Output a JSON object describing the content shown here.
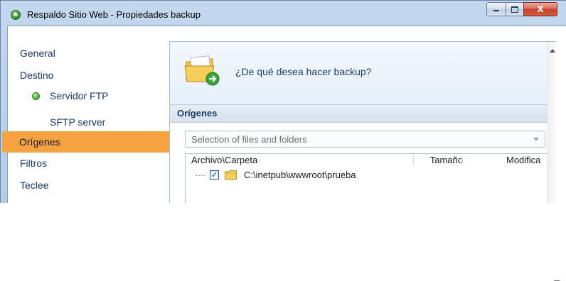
{
  "window": {
    "title": "Respaldo Sitio Web - Propiedades backup",
    "controls": {
      "minimize_icon": "minimize-icon",
      "maximize_icon": "maximize-icon",
      "close_label": "X"
    }
  },
  "sidebar": {
    "items": [
      {
        "label": "General"
      },
      {
        "label": "Destino"
      },
      {
        "label": "Servidor FTP",
        "status": "connected-dot"
      },
      {
        "label": "SFTP server"
      },
      {
        "label": "Orígenes",
        "selected": true
      },
      {
        "label": "Filtros"
      },
      {
        "label": "Teclee"
      }
    ]
  },
  "panel": {
    "question": "¿De qué desea hacer backup?",
    "section_title": "Orígenes",
    "source_select": {
      "value": "Selection of files and folders"
    },
    "tree": {
      "columns": [
        "Archivo\\Carpeta",
        "Tamaño",
        "Modifica"
      ],
      "rows": [
        {
          "checked": true,
          "path": "C:\\inetpub\\wwwroot\\prueba"
        }
      ]
    }
  },
  "colors": {
    "selected_nav": "#f5a340",
    "nav_text": "#1e3a66",
    "header_text": "#1e3a66"
  }
}
